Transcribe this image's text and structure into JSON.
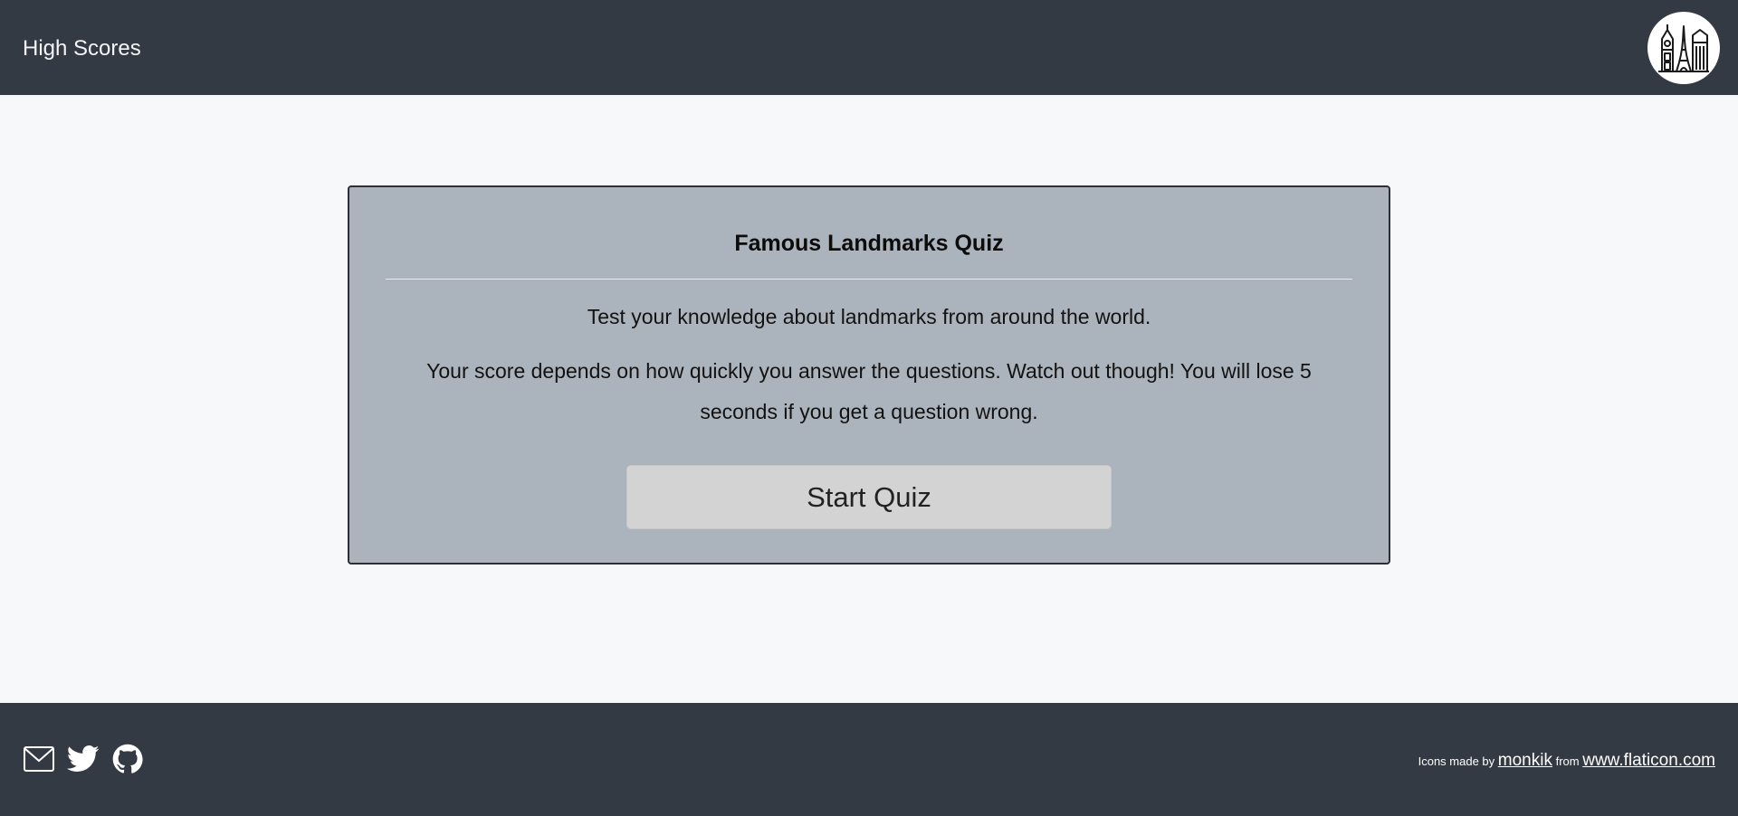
{
  "header": {
    "high_scores_label": "High Scores",
    "logo_icon": "landmarks-logo-icon"
  },
  "card": {
    "title": "Famous Landmarks Quiz",
    "intro": "Test your knowledge about landmarks from around the world.",
    "description": "Your score depends on how quickly you answer the questions. Watch out though! You will lose 5 seconds if you get a question wrong.",
    "start_button_label": "Start Quiz"
  },
  "footer": {
    "social_icons": [
      "mail-icon",
      "twitter-icon",
      "github-icon"
    ],
    "credit_prefix": "Icons made by",
    "credit_author": "monkik",
    "credit_from": "from",
    "credit_site": "www.flaticon.com"
  },
  "colors": {
    "header_bg": "#343a43",
    "page_bg": "#f7f8fa",
    "card_bg": "#abb4bc",
    "button_bg": "#d3d3d3"
  }
}
